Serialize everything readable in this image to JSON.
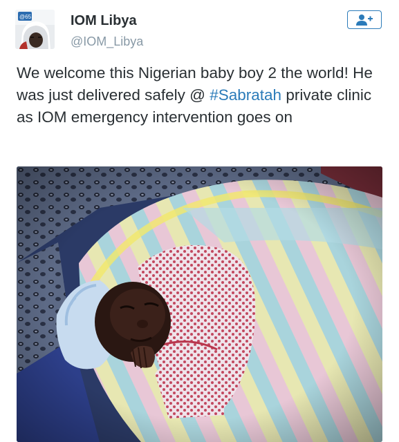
{
  "tweet": {
    "author_name": "IOM Libya",
    "author_handle": "@IOM_Libya",
    "avatar_icon": "iom-profile-avatar",
    "avatar_badge_text": "@65",
    "follow_icon": "add-user-icon",
    "text_before_hashtag": "We welcome this Nigerian baby boy 2 the world! He was just delivered safely @ ",
    "hashtag": "#Sabratah",
    "text_after_hashtag": " private clinic as IOM emergency intervention goes on",
    "photo_subject": "newborn-baby-photo"
  },
  "colors": {
    "link": "#2b7bb9",
    "text": "#292f33",
    "secondary_text": "#8899a6"
  }
}
